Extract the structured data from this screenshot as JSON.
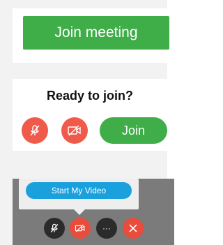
{
  "card1": {
    "join_meeting_label": "Join meeting"
  },
  "card2": {
    "title": "Ready to join?",
    "join_label": "Join"
  },
  "card3": {
    "start_video_label": "Start My Video",
    "more_glyph": "···"
  },
  "colors": {
    "green": "#3fad48",
    "red": "#f05a4b",
    "blue": "#1aa0dd",
    "dark": "#2b2b2b",
    "gray_bg": "#7b7b7b"
  },
  "icons": {
    "mute": "mic-off-icon",
    "camera": "video-off-icon",
    "more": "more-icon",
    "end": "close-icon"
  }
}
